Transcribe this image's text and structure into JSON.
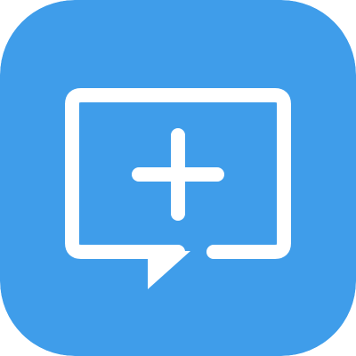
{
  "icon": {
    "name": "new-message-icon",
    "glyph": "plus",
    "colors": {
      "background": "#3F9DEA",
      "foreground": "#FFFFFF"
    }
  }
}
